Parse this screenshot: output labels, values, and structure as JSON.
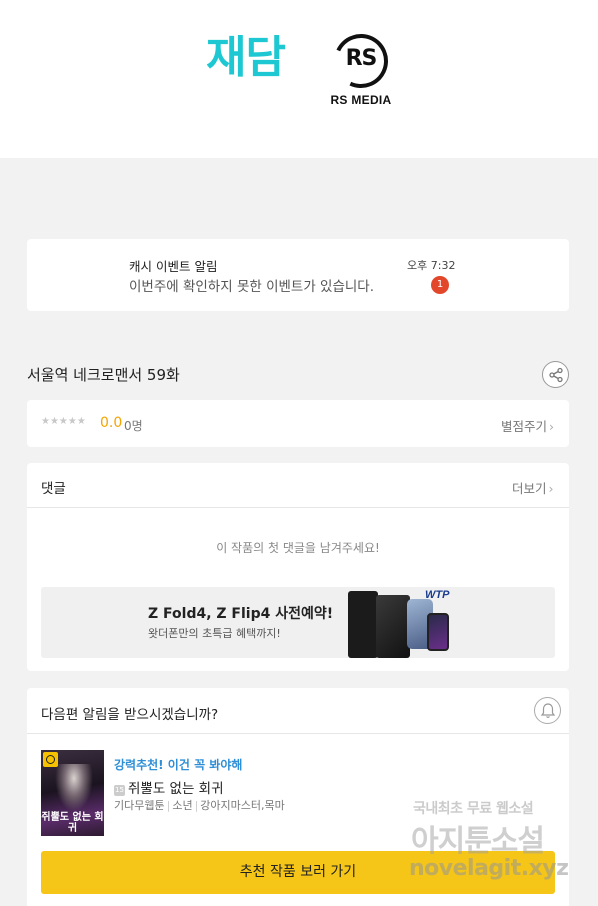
{
  "brand": {
    "jaedam_logo": "재담",
    "rs_logo_letters": "RS",
    "rs_logo_text": "RS MEDIA",
    "jaedam_color": "#1ec8d2"
  },
  "notification": {
    "title": "캐시 이벤트 알림",
    "body": "이번주에 확인하지 못한 이벤트가 있습니다.",
    "time": "오후 7:32",
    "badge_count": "1"
  },
  "episode": {
    "title": "서울역 네크로맨서 59화",
    "share_icon": "share-icon"
  },
  "rating": {
    "stars": "★★★★★",
    "score": "0.0",
    "count": "0명",
    "rate_link": "별점주기",
    "star_fill_fraction": 0
  },
  "comments": {
    "title": "댓글",
    "more_link": "더보기",
    "empty_message": "이 작품의 첫 댓글을 남겨주세요!"
  },
  "ad": {
    "title": "Z Fold4, Z Flip4 사전예약!",
    "subtitle": "왓더폰만의 초특급 혜택까지!",
    "logo": "WTP"
  },
  "next_episode": {
    "question": "다음편 알림을 받으시겠습니까?",
    "bell_icon": "bell-icon"
  },
  "recommendation": {
    "tag": "강력추천! 이건 꼭 봐야해",
    "age_badge": "15",
    "title": "쥐뿔도 없는 회귀",
    "meta": [
      "기다무웹툰",
      "소년",
      "강아지마스터,목마"
    ],
    "thumbnail_caption": "쥐뿔도 없는 회귀",
    "tag_color": "#2f8fd6",
    "cta_label": "추천 작품 보러 가기",
    "cta_color": "#f5c518"
  },
  "watermark": {
    "line1": "국내최초 무료 웹소설",
    "line2": "아지툰소설",
    "line3": "novelagit.xyz"
  }
}
